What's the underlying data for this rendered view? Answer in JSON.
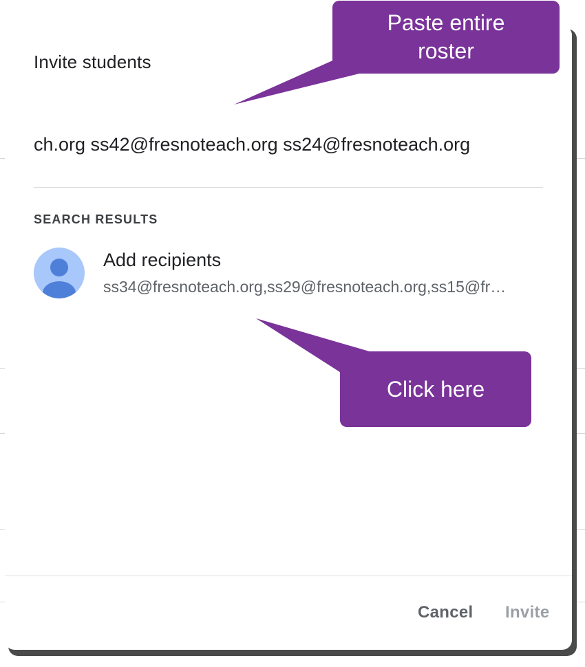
{
  "dialog": {
    "title": "Invite students",
    "input_value": "ch.org ss42@fresnoteach.org ss24@fresnoteach.org",
    "section_label": "SEARCH RESULTS",
    "result": {
      "name": "Add recipients",
      "emails": "ss34@fresnoteach.org,ss29@fresnoteach.org,ss15@fr…",
      "avatar_icon": "person-icon"
    },
    "buttons": {
      "cancel": "Cancel",
      "invite": "Invite"
    }
  },
  "annotations": {
    "top_line1": "Paste entire",
    "top_line2": "roster",
    "bottom": "Click here",
    "color": "#7a3399"
  },
  "colors": {
    "avatar_bg": "#a8c7fa",
    "avatar_fg": "#4f80d9",
    "invite_disabled": "#9aa0a6"
  }
}
